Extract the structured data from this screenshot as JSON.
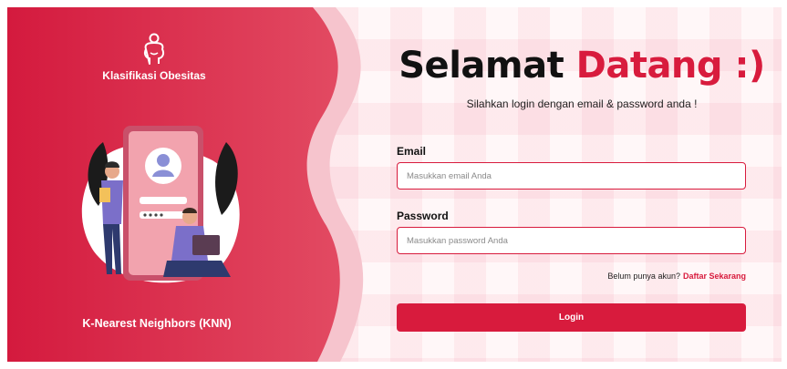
{
  "brand": {
    "name": "Klasifikasi Obesitas",
    "icon": "obese-person-icon"
  },
  "method_label": "K-Nearest Neighbors (KNN)",
  "illustration": "login-profile-illustration",
  "heading": {
    "part1": "Selamat",
    "part2": "Datang :)"
  },
  "subtitle": "Silahkan login dengan email & password anda !",
  "email": {
    "label": "Email",
    "placeholder": "Masukkan email Anda",
    "value": ""
  },
  "password": {
    "label": "Password",
    "placeholder": "Masukkan password Anda",
    "value": ""
  },
  "register": {
    "prompt": "Belum punya akun?",
    "link": "Daftar Sekarang"
  },
  "login_button": "Login",
  "colors": {
    "primary": "#d81b3d",
    "heading_dark": "#111111",
    "panel_gradient_start": "#d41a3e",
    "panel_gradient_end": "#e35a6f"
  }
}
